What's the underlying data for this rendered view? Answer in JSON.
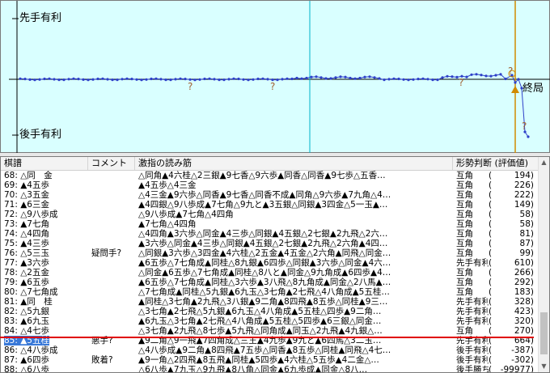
{
  "graph": {
    "label_top": "先手有利",
    "label_bottom": "後手有利",
    "label_end": "終局",
    "question_mark": "?"
  },
  "list": {
    "headers": {
      "move": "棋譜",
      "comment": "コメント",
      "pv": "激指の読み筋",
      "eval": "形勢判断 (評価値)"
    },
    "rows": [
      {
        "move": "68: △同　金",
        "comment": "",
        "pv": "△同角▲4六桂△2三銀▲9七香△9六歩▲同香△同香▲9七歩△五香…",
        "eval": "互角",
        "score": "194)"
      },
      {
        "move": "69: ▲4五歩",
        "comment": "",
        "pv": "▲4五歩△4三金",
        "eval": "互角",
        "score": "226)"
      },
      {
        "move": "70: △3五金",
        "comment": "",
        "pv": "△4三金▲9六歩△同香▲9七香△同香不成▲同角△9六歩▲7九角△4…",
        "eval": "互角",
        "score": "222)"
      },
      {
        "move": "71: ▲6三金",
        "comment": "",
        "pv": "▲4四銀△9八歩成▲7七角△9九と▲3五銀△同銀▲3四金△5一玉▲…",
        "eval": "互角",
        "score": "149)"
      },
      {
        "move": "72: △9八歩成",
        "comment": "",
        "pv": "△9八歩成▲7七角△4四角",
        "eval": "互角",
        "score": "58)"
      },
      {
        "move": "73: ▲7七角",
        "comment": "",
        "pv": "▲7七角△4四角",
        "eval": "互角",
        "score": "58)"
      },
      {
        "move": "74: △4四角",
        "comment": "",
        "pv": "△4四角▲3六歩△同金▲4三歩△同銀▲4五銀△2七銀▲2九飛△2六…",
        "eval": "互角",
        "score": "81)"
      },
      {
        "move": "75: ▲4三歩",
        "comment": "",
        "pv": "▲3六歩△同金▲4三歩△同銀▲4五銀△2七銀▲2九飛△2六角▲4四…",
        "eval": "互角",
        "score": "87)"
      },
      {
        "move": "76: △5三玉",
        "comment": "疑問手?",
        "pv": "△同銀▲3六歩△3四金▲4六桂△2五金▲4五金△2六角▲同飛△同金…",
        "eval": "互角",
        "score": "99)"
      },
      {
        "move": "77: ▲3六歩",
        "comment": "",
        "pv": "▲6五歩△7七角成▲同桂△8九銀▲6四歩△同銀▲3六歩△同金▲4六…",
        "eval": "先手有利",
        "score": "610)"
      },
      {
        "move": "78: △2五金",
        "comment": "",
        "pv": "△同金▲6五歩△7七角成▲同桂△8八と▲同金△9九角成▲6四歩▲4…",
        "eval": "互角",
        "score": "266)"
      },
      {
        "move": "79: ▲6五歩",
        "comment": "",
        "pv": "▲6五歩△7七角成▲同桂△3六歩▲3八飛△8九角成▲同金△2八馬▲…",
        "eval": "互角",
        "score": "292)"
      },
      {
        "move": "80: △7七角成",
        "comment": "",
        "pv": "△7七角成▲同桂△5九銀▲6九玉△3七角▲2七飛△4八角成▲5五桂…",
        "eval": "互角",
        "score": "183)"
      },
      {
        "move": "81: ▲同　桂",
        "comment": "",
        "pv": "▲同桂△3七角▲2九飛△3八銀▲9二角▲8四飛▲8五歩△同桂▲9三…",
        "eval": "先手有利",
        "score": "328)"
      },
      {
        "move": "82: △5九銀",
        "comment": "",
        "pv": "△3七角▲2七飛△5九銀▲6九玉△4八角成▲5五桂△四歩▲9二角…",
        "eval": "先手有利",
        "score": "423)"
      },
      {
        "move": "83: ▲6九玉",
        "comment": "",
        "pv": "▲6九玉△3七角▲2七飛△4八角成▲5五桂△5四歩▲6三銀△同金…",
        "eval": "先手有利",
        "score": "320)"
      },
      {
        "move": "84: △4七歩",
        "comment": "",
        "pv": "△3七角▲2九飛△8七歩▲5九飛△同角成▲同玉△2九飛▲4九銀△…",
        "eval": "互角",
        "score": "270)"
      },
      {
        "move": "85: ▲5五桂",
        "comment": "悪手?",
        "pv": "▲9二角△9一飛▲7四角成△三王▲4九歩▲9九と▲6四馬△3二玉…",
        "eval": "先手有利",
        "score": "664)"
      },
      {
        "move": "86: △4八歩成",
        "comment": "",
        "pv": "△4八歩成▲9二角▲8四飛▲7五歩△同香▲8五歩△同桂▲同飛△4七…",
        "eval": "後手有利",
        "score": "-387)"
      },
      {
        "move": "87: ▲6四歩",
        "comment": "敗着?",
        "pv": "▲9一角△2四飛▲8五飛▲同桂▲5四歩▲4六桂△5五歩▲4二金△…",
        "eval": "後手有利",
        "score": "-302)"
      },
      {
        "move": "88: △6八歩",
        "comment": "",
        "pv": "△6八歩▲7九玉△9九飛▲8八角△同金▲6九歩成▲同金△8八…",
        "eval": "後手勝ち",
        "score": "-99977)"
      }
    ]
  },
  "colors": {
    "graph_bg": "#d9ffff",
    "graph_line": "#2e40c8",
    "marker": "#d08a00",
    "selection": "#3878d8",
    "red_line": "#e00000"
  }
}
